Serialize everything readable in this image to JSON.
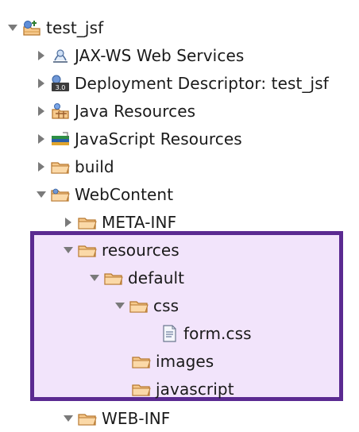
{
  "project": {
    "name": "test_jsf",
    "icon": "web-project-icon",
    "expanded": true
  },
  "tree": [
    {
      "label": "JAX-WS Web Services",
      "icon": "web-services-icon",
      "expanded": false
    },
    {
      "label": "Deployment Descriptor: test_jsf",
      "icon": "deployment-descriptor-icon",
      "expanded": false
    },
    {
      "label": "Java Resources",
      "icon": "java-resources-icon",
      "expanded": false
    },
    {
      "label": "JavaScript Resources",
      "icon": "javascript-resources-icon",
      "expanded": false
    },
    {
      "label": "build",
      "icon": "folder-icon",
      "expanded": false
    },
    {
      "label": "WebContent",
      "icon": "web-folder-icon",
      "expanded": true
    },
    {
      "label": "META-INF",
      "icon": "folder-icon",
      "expanded": false
    },
    {
      "label": "resources",
      "icon": "folder-icon",
      "expanded": true
    },
    {
      "label": "default",
      "icon": "folder-icon",
      "expanded": true
    },
    {
      "label": "css",
      "icon": "folder-icon",
      "expanded": true
    },
    {
      "label": "form.css",
      "icon": "css-file-icon"
    },
    {
      "label": "images",
      "icon": "folder-icon"
    },
    {
      "label": "javascript",
      "icon": "folder-icon"
    },
    {
      "label": "WEB-INF",
      "icon": "folder-icon",
      "expanded": true
    }
  ],
  "colors": {
    "highlight_border": "#5b2a91",
    "highlight_fill": "#f2e4fb",
    "folder_fill": "#f6c98c",
    "folder_stroke": "#b7782f",
    "arrow": "#7a7a7a"
  }
}
